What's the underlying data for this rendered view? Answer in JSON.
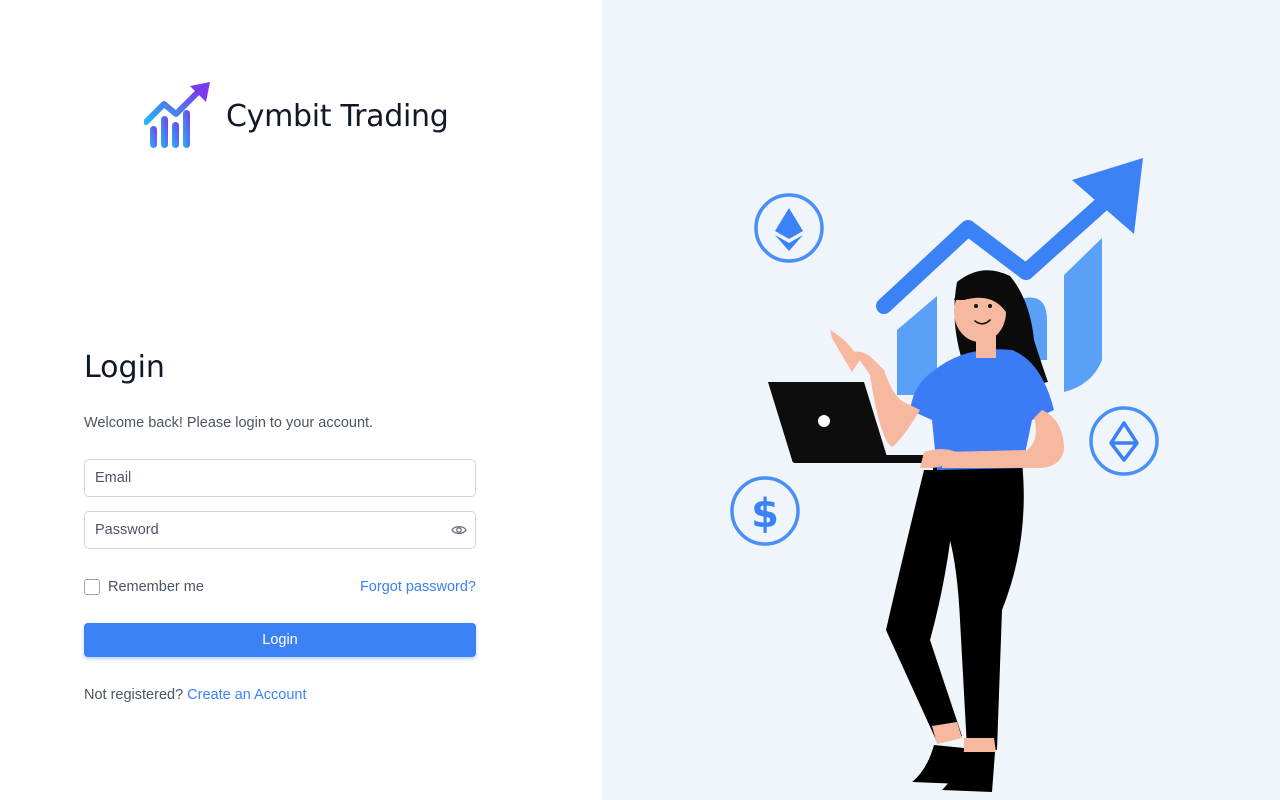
{
  "brand": {
    "name": "Cymbit Trading",
    "logo_icon": "rising-chart-logo-icon"
  },
  "login": {
    "title": "Login",
    "subtitle": "Welcome back! Please login to your account.",
    "email_placeholder": "Email",
    "password_placeholder": "Password",
    "password_toggle_icon": "eye-icon",
    "remember_label": "Remember me",
    "remember_checked": false,
    "forgot_label": "Forgot password?",
    "submit_label": "Login",
    "signup_prompt": "Not registered?",
    "signup_link": "Create an Account"
  },
  "illustration": {
    "icons": [
      "ethereum-coin-icon",
      "ethereum-coin-icon",
      "dollar-coin-icon",
      "trend-arrow-icon"
    ],
    "coin_symbol": "$"
  },
  "colors": {
    "accent": "#3b82f6",
    "panel_bg": "#f0f5fc",
    "text_dark": "#0f172a",
    "text_muted": "#4b5563"
  }
}
